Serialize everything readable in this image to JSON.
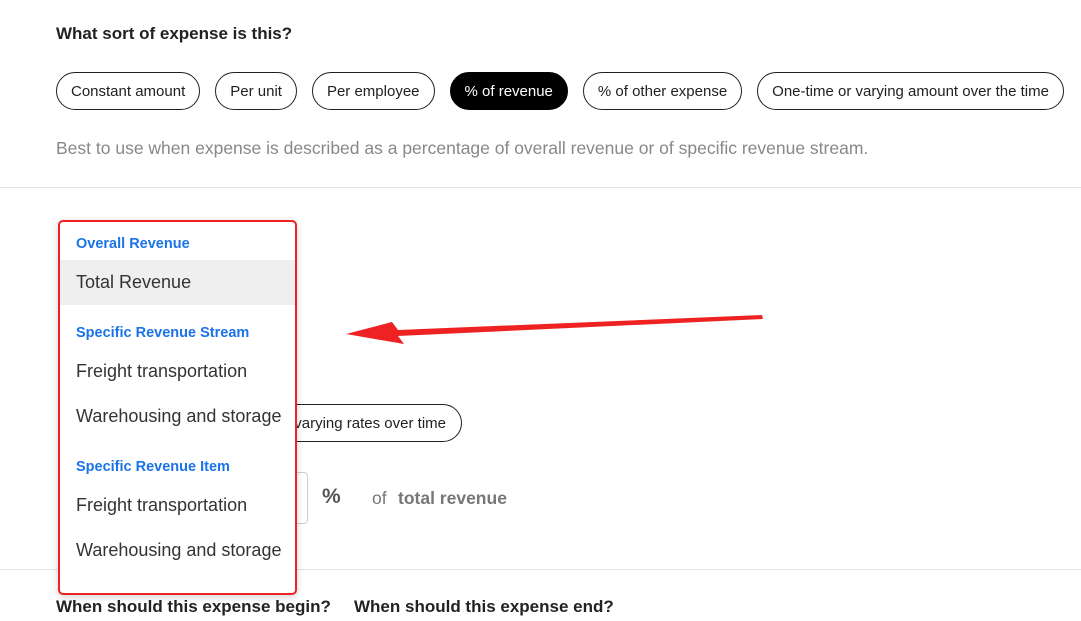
{
  "expense_type": {
    "question": "What sort of expense is this?",
    "options": [
      {
        "label": "Constant amount",
        "selected": false
      },
      {
        "label": "Per unit",
        "selected": false
      },
      {
        "label": "Per employee",
        "selected": false
      },
      {
        "label": "% of revenue",
        "selected": true
      },
      {
        "label": "% of other expense",
        "selected": false
      },
      {
        "label": "One-time or varying amount over the time",
        "selected": false
      }
    ],
    "helper_text": "Best to use when expense is described as a percentage of overall revenue or of specific revenue stream."
  },
  "revenue_section": {
    "rate_option_label": "varying rates over time",
    "percent_symbol": "%",
    "of_label": "of",
    "target_label": "total revenue"
  },
  "dropdown": {
    "groups": [
      {
        "heading": "Overall Revenue",
        "items": [
          "Total Revenue"
        ]
      },
      {
        "heading": "Specific Revenue Stream",
        "items": [
          "Freight transportation",
          "Warehousing and storage"
        ]
      },
      {
        "heading": "Specific Revenue Item",
        "items": [
          "Freight transportation",
          "Warehousing and storage"
        ]
      }
    ],
    "highlighted_item": "Total Revenue"
  },
  "timing": {
    "begin_question": "When should this expense begin?",
    "end_question": "When should this expense end?"
  },
  "colors": {
    "accent_blue": "#1a73e8",
    "annotation_red": "#ee2222",
    "selected_chip": "#000000"
  }
}
